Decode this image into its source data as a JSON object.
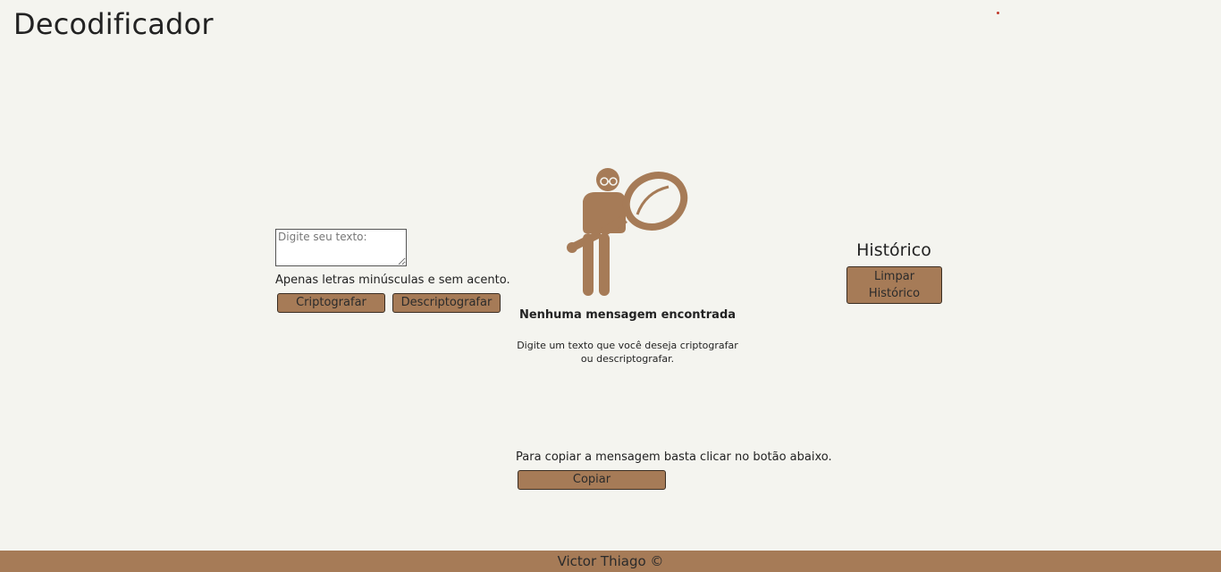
{
  "header": {
    "title": "Decodificador"
  },
  "input": {
    "placeholder": "Digite seu texto:",
    "value": ""
  },
  "hint": "Apenas letras minúsculas e sem acento.",
  "buttons": {
    "encrypt": "Criptografar",
    "decrypt": "Descriptografar",
    "clear_history": "Limpar Histórico",
    "copy": "Copiar"
  },
  "output": {
    "illustration": "person-magnifier-icon",
    "empty_title": "Nenhuma mensagem encontrada",
    "empty_desc_line1": "Digite um texto que você deseja criptografar",
    "empty_desc_line2": "ou descriptografar."
  },
  "history": {
    "title": "Histórico"
  },
  "copy_hint": "Para copiar a mensagem basta clicar no botão abaixo.",
  "footer": {
    "credit": "Victor Thiago ©"
  },
  "colors": {
    "accent": "#a67b57",
    "background": "#f4f4ef",
    "text": "#222222"
  }
}
